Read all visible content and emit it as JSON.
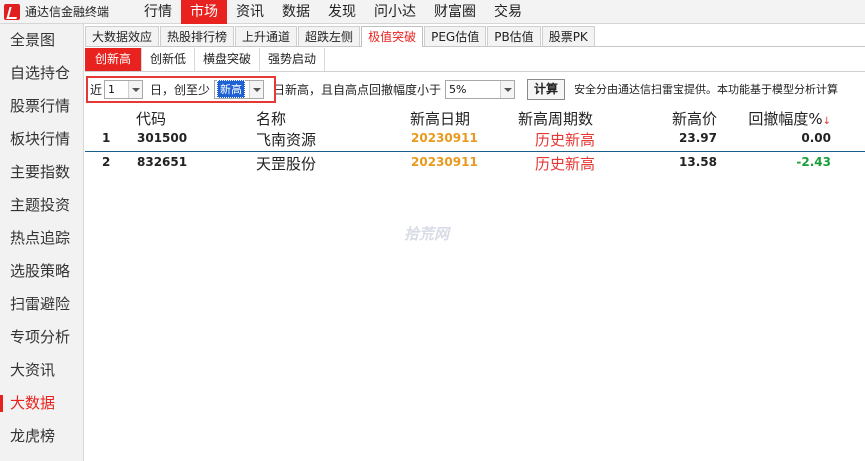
{
  "app": {
    "title": "通达信金融终端"
  },
  "topmenu": [
    "行情",
    "市场",
    "资讯",
    "数据",
    "发现",
    "问小达",
    "财富圈",
    "交易"
  ],
  "sidebar": [
    "全景图",
    "自选持仓",
    "股票行情",
    "板块行情",
    "主要指数",
    "主题投资",
    "热点追踪",
    "选股策略",
    "扫雷避险",
    "专项分析",
    "大资讯",
    "大数据",
    "龙虎榜"
  ],
  "tabs_primary": [
    "大数据效应",
    "热股排行榜",
    "上升通道",
    "超跌左侧",
    "极值突破",
    "PEG估值",
    "PB估值",
    "股票PK"
  ],
  "tabs_secondary": [
    "创新高",
    "创新低",
    "横盘突破",
    "强势启动"
  ],
  "filter": {
    "prefix": "近",
    "days": "1",
    "mid_text": "日，创至少",
    "level": "新高",
    "condition_text": "日新高，且自高点回撤幅度小于",
    "pullback": "5%",
    "calc_label": "计算",
    "note": "安全分由通达信扫雷宝提供。本功能基于模型分析计算"
  },
  "table": {
    "headers": {
      "code": "代码",
      "name": "名称",
      "date": "新高日期",
      "period": "新高周期数",
      "price": "新高价",
      "pullback": "回撤幅度%"
    },
    "sort_indicator": "↓",
    "rows": [
      {
        "idx": "1",
        "code": "301500",
        "name": "飞南资源",
        "date": "20230911",
        "period": "历史新高",
        "price": "23.97",
        "pullback": "0.00",
        "pullback_color": "#222222"
      },
      {
        "idx": "2",
        "code": "832651",
        "name": "天罡股份",
        "date": "20230911",
        "period": "历史新高",
        "price": "13.58",
        "pullback": "-2.43",
        "pullback_color": "#1a9e3a"
      }
    ]
  },
  "watermark": "拾荒网",
  "colors": {
    "accent": "#e8231f",
    "date": "#e89a1e",
    "period": "#e53935",
    "negative": "#1a9e3a"
  }
}
